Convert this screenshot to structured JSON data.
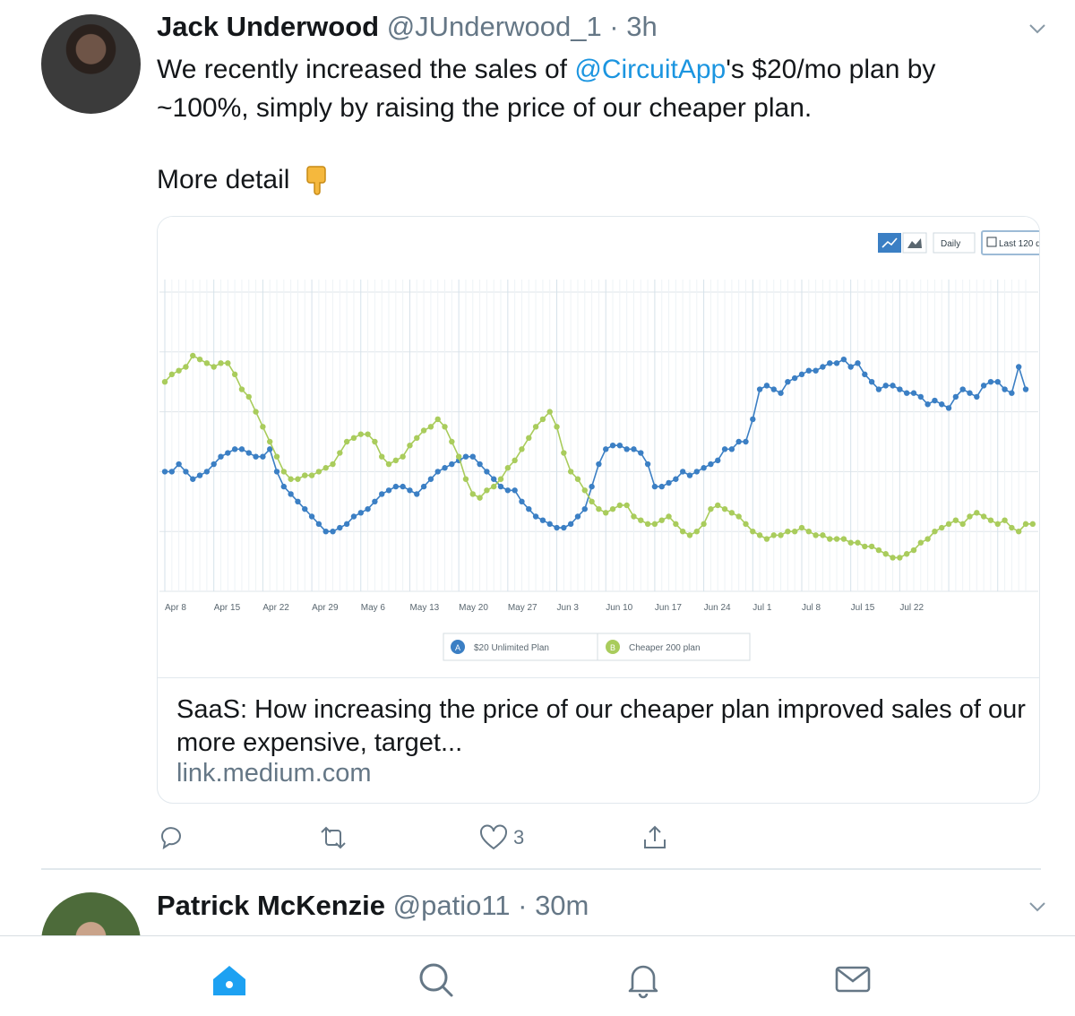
{
  "tweet": {
    "name": "Jack Underwood",
    "handle": "@JUnderwood_1",
    "time": "3h",
    "text_before": "We recently increased the sales of ",
    "mention": "@CircuitApp",
    "text_after": "'s $20/mo plan by ~100%, simply by raising the price of our cheaper plan.",
    "more_detail": "More detail",
    "emoji": "pointing-down-icon",
    "card": {
      "title": "SaaS: How increasing the price of our cheaper plan improved sales of our more expensive, target...",
      "domain": "link.medium.com"
    },
    "actions": {
      "reply": "",
      "retweet": "",
      "like_count": "3",
      "share": ""
    }
  },
  "chart_ui": {
    "interval": "Daily",
    "range": "Last 120 d"
  },
  "chart_data": {
    "type": "line",
    "x_ticks": [
      "Apr 8",
      "Apr 15",
      "Apr 22",
      "Apr 29",
      "May 6",
      "May 13",
      "May 20",
      "May 27",
      "Jun 3",
      "Jun 10",
      "Jun 17",
      "Jun 24",
      "Jul 1",
      "Jul 8",
      "Jul 15",
      "Jul 22"
    ],
    "series": [
      {
        "name": "$20 Unlimited Plan",
        "legend_badge": "A",
        "color": "#3b7fc4",
        "values": [
          36,
          36,
          37,
          36,
          35,
          35.5,
          36,
          37,
          38,
          38.5,
          39,
          39,
          38.5,
          38,
          38,
          39,
          36,
          34,
          33,
          32,
          31,
          30,
          29,
          28,
          28,
          28.5,
          29,
          30,
          30.5,
          31,
          32,
          33,
          33.5,
          34,
          34,
          33.5,
          33,
          34,
          35,
          36,
          36.5,
          37,
          37.5,
          38,
          38,
          37,
          36,
          35,
          34,
          33.5,
          33.5,
          32,
          31,
          30,
          29.5,
          29,
          28.5,
          28.5,
          29,
          30,
          31,
          34,
          37,
          39,
          39.5,
          39.5,
          39,
          39,
          38.5,
          37,
          34,
          34,
          34.5,
          35,
          36,
          35.5,
          36,
          36.5,
          37,
          37.5,
          39,
          39,
          40,
          40,
          43,
          47,
          47.5,
          47,
          46.5,
          48,
          48.5,
          49,
          49.5,
          49.5,
          50,
          50.5,
          50.5,
          51,
          50,
          50.5,
          49,
          48,
          47,
          47.5,
          47.5,
          47,
          46.5,
          46.5,
          46,
          45,
          45.5,
          45,
          44.5,
          46,
          47,
          46.5,
          46,
          47.5,
          48,
          48,
          47,
          46.5,
          50,
          47
        ]
      },
      {
        "name": "Cheaper 200 plan",
        "legend_badge": "B",
        "color": "#a9cc5c",
        "values": [
          48,
          49,
          49.5,
          50,
          51.5,
          51,
          50.5,
          50,
          50.5,
          50.5,
          49,
          47,
          46,
          44,
          42,
          40,
          38,
          36,
          35,
          35,
          35.5,
          35.5,
          36,
          36.5,
          37,
          38.5,
          40,
          40.5,
          41,
          41,
          40,
          38,
          37,
          37.5,
          38,
          39.5,
          40.5,
          41.5,
          42,
          43,
          42,
          40,
          38,
          35,
          33,
          32.5,
          33.5,
          34,
          35,
          36.5,
          37.5,
          39,
          40.5,
          42,
          43,
          44,
          42,
          38.5,
          36,
          35,
          33.5,
          32,
          31,
          30.5,
          31,
          31.5,
          31.5,
          30,
          29.5,
          29,
          29,
          29.5,
          30,
          29,
          28,
          27.5,
          28,
          29,
          31,
          31.5,
          31,
          30.5,
          30,
          29,
          28,
          27.5,
          27,
          27.5,
          27.5,
          28,
          28,
          28.5,
          28,
          27.5,
          27.5,
          27,
          27,
          27,
          26.5,
          26.5,
          26,
          26,
          25.5,
          25,
          24.5,
          24.5,
          25,
          25.5,
          26.5,
          27,
          28,
          28.5,
          29,
          29.5,
          29,
          30,
          30.5,
          30,
          29.5,
          29,
          29.5,
          28.5,
          28,
          29,
          29
        ]
      }
    ],
    "ylim": [
      20,
      60
    ],
    "grid": true,
    "legend_position": "bottom"
  },
  "tweet2": {
    "name": "Patrick McKenzie",
    "handle": "@patio11",
    "time": "30m"
  },
  "tabbar": {
    "home": "home-icon",
    "search": "search-icon",
    "notifications": "bell-icon",
    "messages": "mail-icon"
  }
}
